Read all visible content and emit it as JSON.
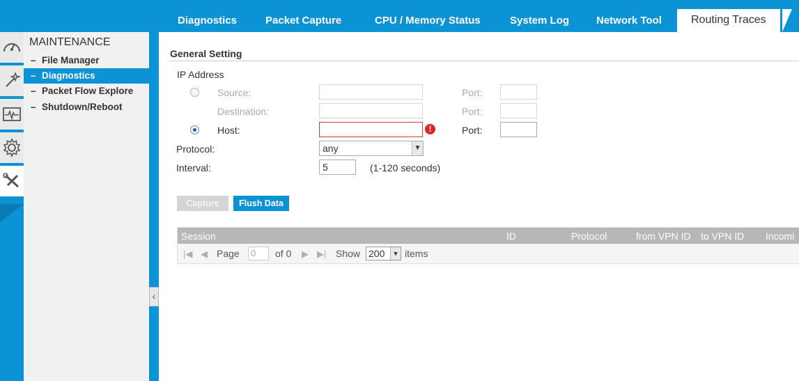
{
  "tabs": [
    {
      "label": "Diagnostics"
    },
    {
      "label": "Packet Capture"
    },
    {
      "label": "CPU / Memory Status"
    },
    {
      "label": "System Log"
    },
    {
      "label": "Network Tool"
    },
    {
      "label": "Routing Traces"
    }
  ],
  "active_tab": "Routing Traces",
  "rail": {
    "items": [
      "dashboard-icon",
      "wand-icon",
      "monitor-icon",
      "gear-icon",
      "tools-icon"
    ],
    "active": "tools-icon"
  },
  "sidebar": {
    "section_title": "MAINTENANCE",
    "items": [
      {
        "label": "File Manager"
      },
      {
        "label": "Diagnostics"
      },
      {
        "label": "Packet Flow Explore"
      },
      {
        "label": "Shutdown/Reboot"
      }
    ],
    "active": "Diagnostics"
  },
  "form": {
    "group_title": "General Setting",
    "ip_address_label": "IP Address",
    "source_label": "Source:",
    "destination_label": "Destination:",
    "host_label": "Host:",
    "port_label": "Port:",
    "source_value": "",
    "destination_value": "",
    "host_value": "",
    "selected_mode": "Host",
    "protocol_label": "Protocol:",
    "protocol_value": "any",
    "interval_label": "Interval:",
    "interval_value": "5",
    "interval_hint": "(1-120 seconds)",
    "error_icon": "!"
  },
  "buttons": {
    "capture": "Capture",
    "flush": "Flush Data"
  },
  "grid": {
    "columns": [
      "Session",
      "ID",
      "Protocol",
      "from VPN ID",
      "to VPN ID",
      "Incomi"
    ],
    "pager": {
      "page_label": "Page",
      "page_value": "0",
      "of_label": "of 0",
      "show_label": "Show",
      "show_value": "200",
      "items_label": "items"
    }
  },
  "colors": {
    "accent": "#0c93d6",
    "header_gray": "#b7b7b7",
    "error": "#e02424"
  }
}
